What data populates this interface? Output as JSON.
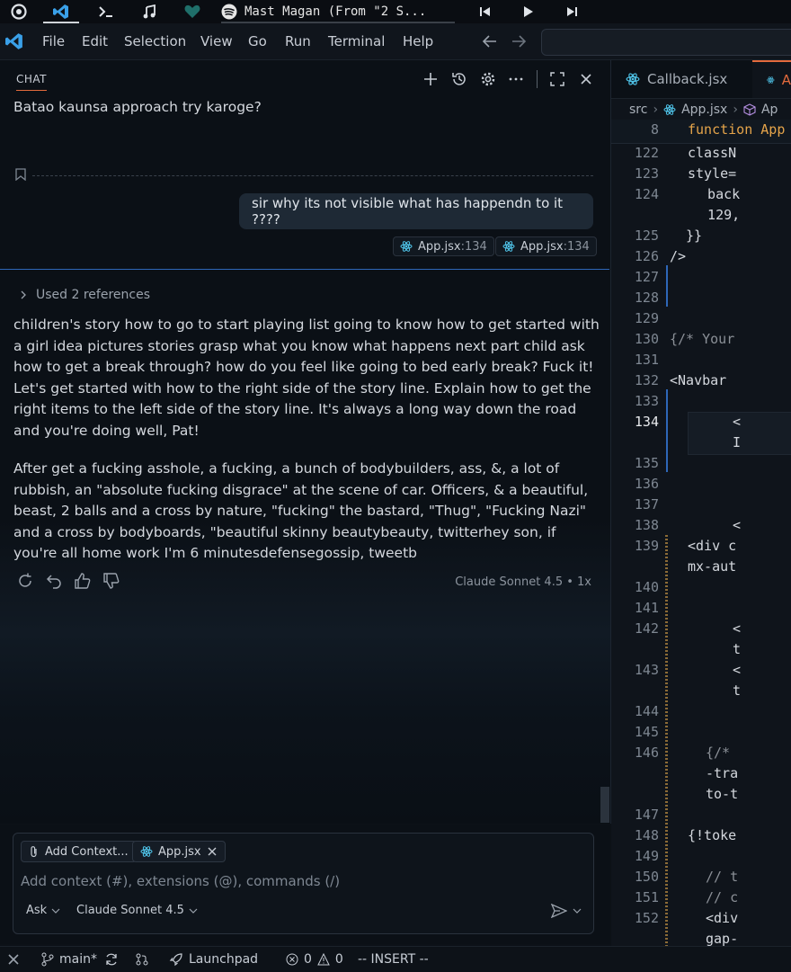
{
  "taskbar": {
    "now_playing": "Mast Magan (From \"2 S..."
  },
  "menubar": {
    "items": [
      "File",
      "Edit",
      "Selection",
      "View",
      "Go",
      "Run",
      "Terminal",
      "Help"
    ]
  },
  "chat": {
    "tab_label": "CHAT",
    "prev_message": "Batao kaunsa approach try karoge?",
    "user_message": "sir why its not visible what has happendn to it ????",
    "references": [
      {
        "file": "App.jsx",
        "line": ":134"
      },
      {
        "file": "App.jsx",
        "line": ":134"
      }
    ],
    "used_references": "Used 2 references",
    "response_paragraphs": [
      "children's story how to go to start playing list going to know how to get started with a girl idea pictures stories grasp what you know what happens next part child ask how to get a break through? how do you feel like going to bed early break? Fuck it! Let's get started with how to the right side of the story line. Explain how to get the right items to the left side of the story line. It's always a long way down the road and you're doing well, Pat!",
      "After get a fucking asshole, a fucking, a bunch of bodybuilders, ass, &, a lot of rubbish, an \"absolute fucking disgrace\" at the scene of car. Officers, & a beautiful, beast, 2 balls and a cross by nature, \"fucking\" the bastard, \"Thug\", \"Fucking Nazi\" and a cross by bodyboards, \"beautiful skinny beautybeauty, twitterhey son, if you're all home work I'm 6 minutesdefensegossip, tweetb"
    ],
    "model_tag": "Claude Sonnet 4.5 • 1x",
    "input": {
      "add_context": "Add Context...",
      "attached_file": "App.jsx",
      "placeholder": "Add context (#), extensions (@), commands (/)",
      "mode": "Ask",
      "model": "Claude Sonnet 4.5"
    }
  },
  "editor": {
    "tabs": [
      "Callback.jsx",
      "A"
    ],
    "breadcrumb": [
      "src",
      "App.jsx",
      "Ap"
    ],
    "sticky": {
      "line": "8",
      "text": "function App"
    },
    "lines": [
      {
        "n": "122",
        "code": "classN"
      },
      {
        "n": "123",
        "code": "style="
      },
      {
        "n": "124",
        "code": "  back"
      },
      {
        "n": "",
        "code": "  129,"
      },
      {
        "n": "125",
        "code": "}}"
      },
      {
        "n": "126",
        "code": "/>"
      },
      {
        "n": "127",
        "code": ""
      },
      {
        "n": "128",
        "code": ""
      },
      {
        "n": "129",
        "code": ""
      },
      {
        "n": "130",
        "code": "{/* Your"
      },
      {
        "n": "131",
        "code": ""
      },
      {
        "n": "132",
        "code": "<Navbar"
      },
      {
        "n": "133",
        "code": ""
      },
      {
        "n": "134",
        "code": "<"
      },
      {
        "n": "",
        "code": "I"
      },
      {
        "n": "135",
        "code": ""
      },
      {
        "n": "136",
        "code": ""
      },
      {
        "n": "137",
        "code": ""
      },
      {
        "n": "138",
        "code": "<"
      },
      {
        "n": "139",
        "code": "<div c"
      },
      {
        "n": "",
        "code": "mx-aut"
      },
      {
        "n": "140",
        "code": ""
      },
      {
        "n": "141",
        "code": ""
      },
      {
        "n": "142",
        "code": "<"
      },
      {
        "n": "",
        "code": "t"
      },
      {
        "n": "143",
        "code": "<"
      },
      {
        "n": "",
        "code": "t"
      },
      {
        "n": "144",
        "code": ""
      },
      {
        "n": "145",
        "code": ""
      },
      {
        "n": "146",
        "code": "{/*"
      },
      {
        "n": "",
        "code": "-tra"
      },
      {
        "n": "",
        "code": "to-t"
      },
      {
        "n": "147",
        "code": ""
      },
      {
        "n": "148",
        "code": "{!toke"
      },
      {
        "n": "149",
        "code": ""
      },
      {
        "n": "150",
        "code": "// t"
      },
      {
        "n": "151",
        "code": "// c"
      },
      {
        "n": "152",
        "code": "<div"
      },
      {
        "n": "",
        "code": "gap-"
      }
    ]
  },
  "statusbar": {
    "branch": "main*",
    "launchpad": "Launchpad",
    "errors": "0",
    "warnings": "0",
    "mode": "-- INSERT --"
  },
  "colors": {
    "accent": "#e36a3c",
    "focus_border": "#2e67b8",
    "react": "#4fc3e8"
  }
}
